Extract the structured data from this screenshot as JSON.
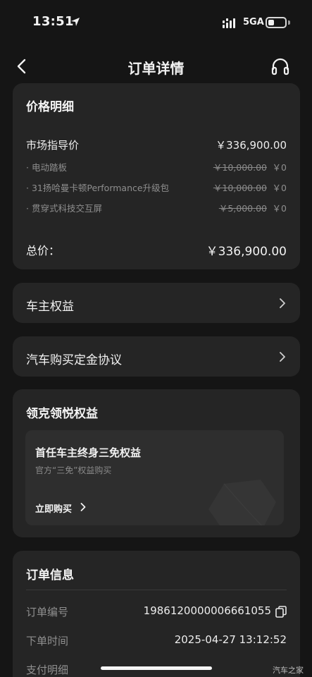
{
  "status_bar": {
    "time": "13:51",
    "network": "5GA",
    "icons": [
      "location-arrow-icon",
      "signal-icon",
      "battery-icon"
    ]
  },
  "header": {
    "title": "订单详情",
    "icons": [
      "chevron-left-icon",
      "headset-icon"
    ]
  },
  "price_detail": {
    "title": "价格明细",
    "msrp_label": "市场指导价",
    "msrp_value": "￥336,900.00",
    "items": [
      {
        "label": "· 电动踏板",
        "original": "￥10,000.00",
        "price": "￥0"
      },
      {
        "label": "· 31扬哈曼卡顿Performance升级包",
        "original": "￥10,000.00",
        "price": "￥0"
      },
      {
        "label": "· 贯穿式科技交互屏",
        "original": "￥5,000.00",
        "price": "￥0"
      }
    ],
    "total_label": "总价：",
    "total_value": "￥336,900.00"
  },
  "owner_benefits": {
    "label": "车主权益"
  },
  "deposit_agreement": {
    "label": "汽车购买定金协议"
  },
  "lynk_benefits": {
    "title": "领克领悦权益",
    "card_title": "首任车主终身三免权益",
    "card_subtitle": "官方“三免”权益购买",
    "buy_label": "立即购买"
  },
  "order_info": {
    "title": "订单信息",
    "order_no_label": "订单编号",
    "order_no_value": "1986120000006661055",
    "order_time_label": "下单时间",
    "order_time_value": "2025-04-27 13:12:52",
    "payment_label": "支付明细"
  },
  "watermark": "汽车之家",
  "colors": {
    "background": "#151515",
    "card": "#252525",
    "inner_card": "#2e2e2e",
    "muted_text": "#8e8e8e"
  }
}
